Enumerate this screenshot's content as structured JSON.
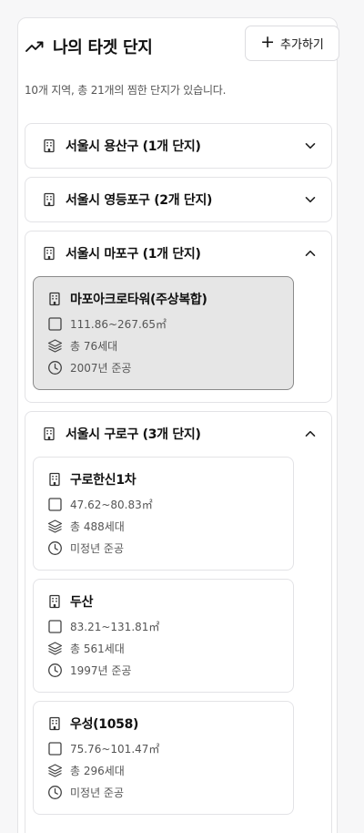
{
  "header": {
    "title": "나의 타겟 단지",
    "add_label": "추가하기"
  },
  "summary": "10개 지역, 총 21개의 찜한 단지가 있습니다.",
  "regions": [
    {
      "name": "서울시 용산구 (1개 단지)",
      "expanded": false
    },
    {
      "name": "서울시 영등포구 (2개 단지)",
      "expanded": false
    },
    {
      "name": "서울시 마포구 (1개 단지)",
      "expanded": true,
      "complexes": [
        {
          "name": "마포아크로타워(주상복합)",
          "area": "111.86~267.65㎡",
          "households": "총 76세대",
          "built": "2007년 준공",
          "selected": true
        }
      ]
    },
    {
      "name": "서울시 구로구 (3개 단지)",
      "expanded": true,
      "complexes": [
        {
          "name": "구로한신1차",
          "area": "47.62~80.83㎡",
          "households": "총 488세대",
          "built": "미정년 준공",
          "selected": false
        },
        {
          "name": "두산",
          "area": "83.21~131.81㎡",
          "households": "총 561세대",
          "built": "1997년 준공",
          "selected": false
        },
        {
          "name": "우성(1058)",
          "area": "75.76~101.47㎡",
          "households": "총 296세대",
          "built": "미정년 준공",
          "selected": false
        }
      ]
    }
  ],
  "icons": {
    "title": "trending-up-icon",
    "region": "building-icon",
    "area": "square-icon",
    "households": "layers-icon",
    "built": "clock-icon"
  }
}
